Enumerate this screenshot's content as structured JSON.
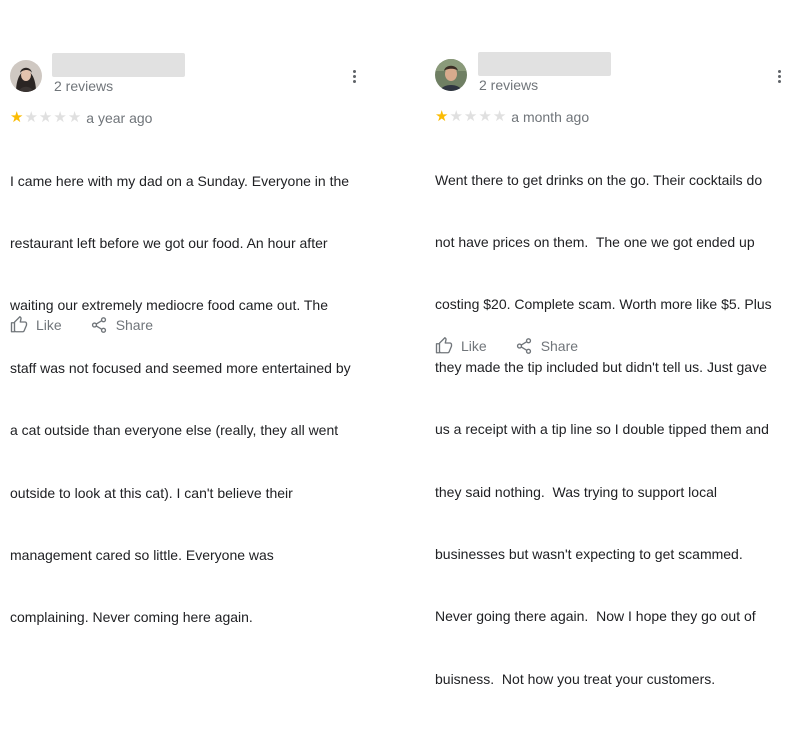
{
  "reviews": [
    {
      "review_count": "2 reviews",
      "rating": 1,
      "max_rating": 5,
      "date": "a year ago",
      "text_lines": [
        "I came here with my dad on a Sunday. Everyone in the",
        "restaurant left before we got our food. An hour after",
        "waiting our extremely mediocre food came out. The",
        "staff was not focused and seemed more entertained by",
        "a cat outside than everyone else (really, they all went",
        "outside to look at this cat). I can't believe their",
        "management cared so little. Everyone was",
        "complaining. Never coming here again."
      ],
      "like_label": "Like",
      "share_label": "Share"
    },
    {
      "review_count": "2 reviews",
      "rating": 1,
      "max_rating": 5,
      "date": "a month ago",
      "text_lines": [
        "Went there to get drinks on the go. Their cocktails do",
        "not have prices on them.  The one we got ended up",
        "costing $20. Complete scam. Worth more like $5. Plus",
        "they made the tip included but didn't tell us. Just gave",
        "us a receipt with a tip line so I double tipped them and",
        "they said nothing.  Was trying to support local",
        "businesses but wasn't expecting to get scammed.",
        "Never going there again.  Now I hope they go out of",
        "buisness.  Not how you treat your customers."
      ],
      "like_label": "Like",
      "share_label": "Share"
    }
  ],
  "colors": {
    "star_filled": "#fbbc04",
    "star_empty": "#e0e0e0",
    "secondary_text": "#70757a",
    "body_text": "#202124",
    "redaction": "#e1e1e1"
  },
  "icons": [
    "avatar-photo",
    "more-vert-icon",
    "star-icon",
    "thumb-up-icon",
    "share-icon"
  ]
}
